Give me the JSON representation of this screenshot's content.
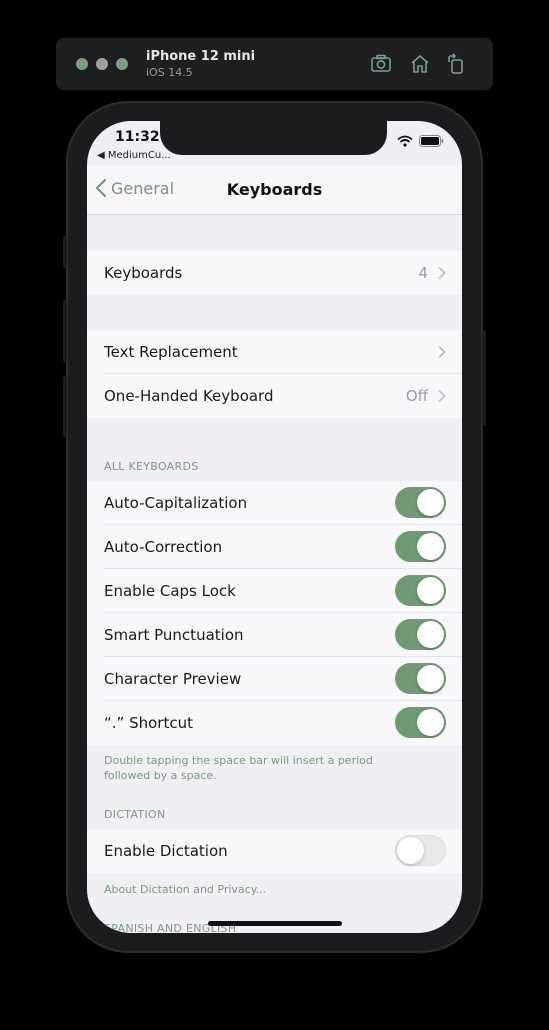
{
  "simulator": {
    "device_name": "iPhone 12 mini",
    "os_version": "iOS 14.5",
    "icons": [
      "screenshot-icon",
      "home-icon",
      "rotate-icon"
    ]
  },
  "status_bar": {
    "time": "11:32",
    "back_app": "◀ MediumCu..."
  },
  "nav": {
    "back_label": "General",
    "title": "Keyboards"
  },
  "colors": {
    "accent": "#74977a",
    "toggle_on": "#6f9a73"
  },
  "rows": {
    "keyboards": {
      "label": "Keyboards",
      "value": "4"
    },
    "text_replacement": {
      "label": "Text Replacement"
    },
    "one_handed": {
      "label": "One-Handed Keyboard",
      "value": "Off"
    }
  },
  "all_keyboards": {
    "header": "ALL KEYBOARDS",
    "toggles": [
      {
        "label": "Auto-Capitalization",
        "on": true
      },
      {
        "label": "Auto-Correction",
        "on": true
      },
      {
        "label": "Enable Caps Lock",
        "on": true
      },
      {
        "label": "Smart Punctuation",
        "on": true
      },
      {
        "label": "Character Preview",
        "on": true
      },
      {
        "label": "“.” Shortcut",
        "on": true
      }
    ],
    "footer": "Double tapping the space bar will insert a period followed by a space."
  },
  "dictation": {
    "header": "DICTATION",
    "toggle": {
      "label": "Enable Dictation",
      "on": false
    },
    "footer": "About Dictation and Privacy..."
  },
  "spanish": {
    "header": "SPANISH AND ENGLISH"
  }
}
